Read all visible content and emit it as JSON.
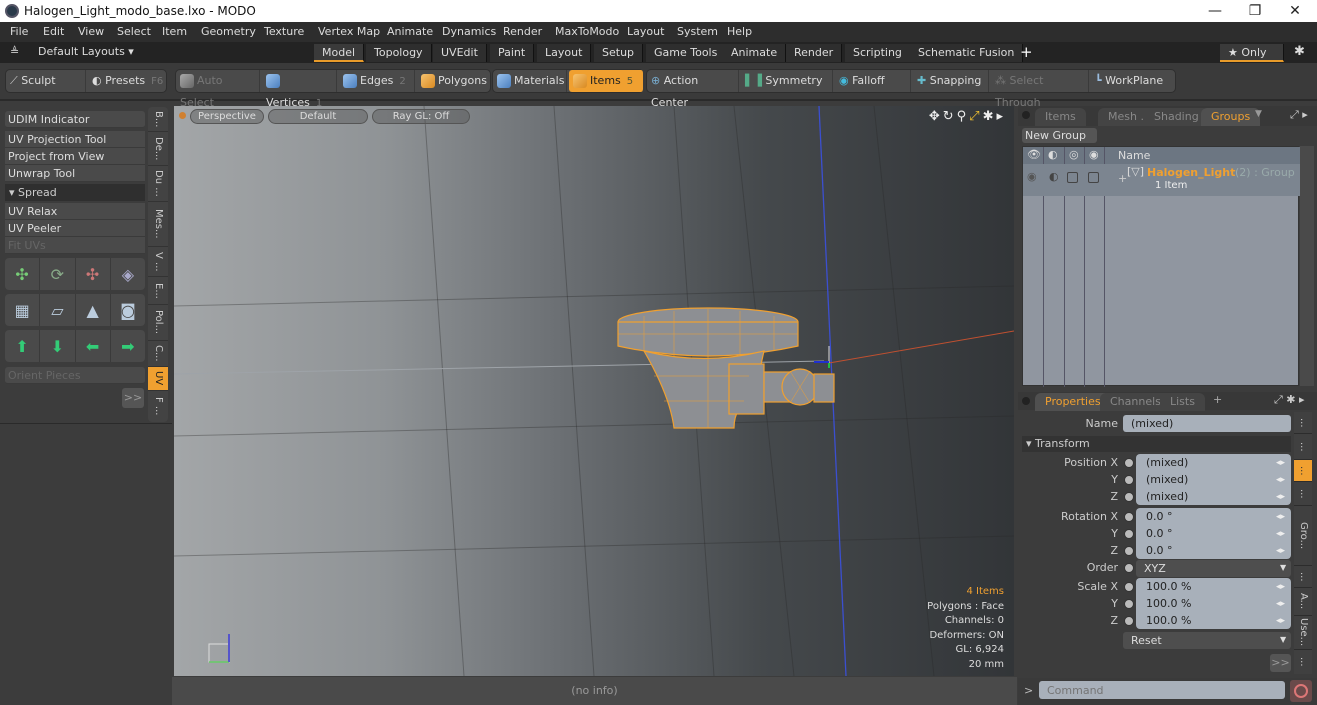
{
  "window": {
    "title": "Halogen_Light_modo_base.lxo - MODO",
    "minimize": "—",
    "maximize": "❐",
    "close": "✕"
  },
  "menu": [
    "File",
    "Edit",
    "View",
    "Select",
    "Item",
    "Geometry",
    "Texture",
    "Vertex Map",
    "Animate",
    "Dynamics",
    "Render",
    "MaxToModo",
    "Layout",
    "System",
    "Help"
  ],
  "layoutbar": {
    "layouts_label": "Default Layouts ▾",
    "tabs": [
      "Model",
      "Topology",
      "UVEdit",
      "Paint",
      "Layout",
      "Setup",
      "Game Tools",
      "Animate",
      "Render",
      "Scripting",
      "Schematic Fusion"
    ],
    "active_tab": "Model",
    "add": "+",
    "only": "★ Only",
    "gear": "✱"
  },
  "toolbar": {
    "sculpt": "Sculpt",
    "presets": "Presets",
    "presets_key": "F6",
    "auto_select": "Auto Select",
    "vertices": "Vertices",
    "vertices_key": "1",
    "edges": "Edges",
    "edges_key": "2",
    "polygons": "Polygons",
    "materials": "Materials",
    "items": "Items",
    "items_key": "5",
    "action_center": "Action Center",
    "symmetry": "Symmetry",
    "falloff": "Falloff",
    "snapping": "Snapping",
    "select_through": "Select Through",
    "workplane": "WorkPlane"
  },
  "leftpanel": {
    "udim": "UDIM Indicator",
    "uv_projection": "UV Projection Tool",
    "project_from_view": "Project from View",
    "unwrap": "Unwrap Tool",
    "spread_header": "▾ Spread",
    "uv_relax": "UV Relax",
    "uv_peeler": "UV Peeler",
    "fit_uvs": "Fit UVs",
    "orient_pieces": "Orient Pieces",
    "more": ">>",
    "vtabs": [
      "B...",
      "De...",
      "Du ...",
      "Mes...",
      "V ...",
      "E...",
      "Pol...",
      "C...",
      "UV",
      "F ..."
    ],
    "active_vtab": "UV"
  },
  "viewport": {
    "perspective": "Perspective",
    "default": "Default",
    "raygl": "Ray GL: Off",
    "info": {
      "items": "4 Items",
      "polygons": "Polygons : Face",
      "channels": "Channels: 0",
      "deformers": "Deformers: ON",
      "gl": "GL: 6,924",
      "scale": "20 mm"
    }
  },
  "status": {
    "text": "(no info)"
  },
  "rightpanel": {
    "tabs": [
      "Items",
      "Mesh ...",
      "Shading",
      "Groups"
    ],
    "active_tab": "Groups",
    "new_group": "New Group",
    "col_name": "Name",
    "group": {
      "name": "Halogen_Light",
      "suffix": "(2) : Group",
      "sub": "1 Item"
    },
    "prop_tabs": [
      "Properties",
      "Channels",
      "Lists"
    ],
    "prop_active": "Properties",
    "add": "+",
    "name_label": "Name",
    "name_value": "(mixed)",
    "transform_header": "▾ Transform",
    "position": {
      "label_x": "Position X",
      "x": "(mixed)",
      "y": "(mixed)",
      "z": "(mixed)"
    },
    "rotation": {
      "label_x": "Rotation X",
      "x": "0.0 °",
      "y": "0.0 °",
      "z": "0.0 °"
    },
    "order_label": "Order",
    "order_value": "XYZ",
    "scale": {
      "label_x": "Scale X",
      "x": "100.0 %",
      "y": "100.0 %",
      "z": "100.0 %"
    },
    "axis_y": "Y",
    "axis_z": "Z",
    "reset": "Reset",
    "more": ">>",
    "rvtabs": [
      "...",
      "...",
      "...",
      "...",
      "Gro...",
      "...",
      "A...",
      "Use...",
      "..."
    ],
    "rvtab_active_index": 2
  },
  "command": {
    "placeholder": "Command",
    "prompt": ">"
  }
}
